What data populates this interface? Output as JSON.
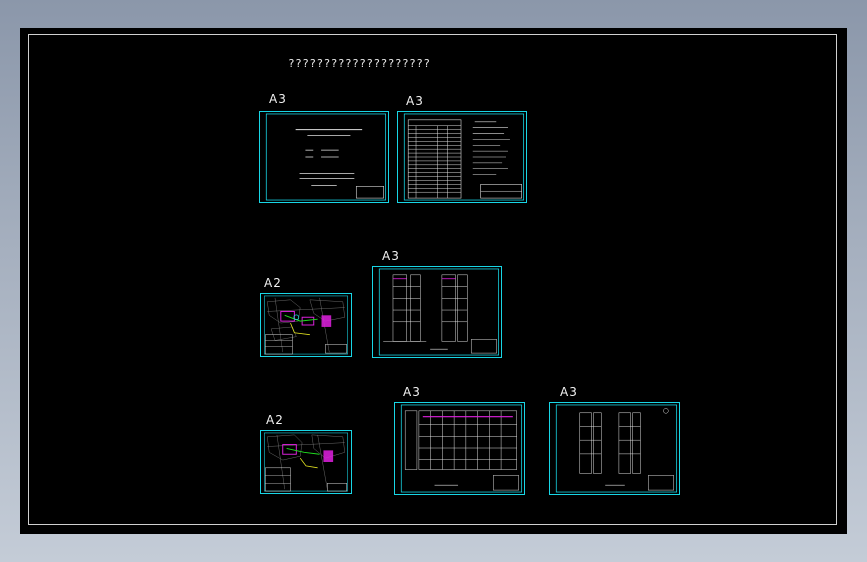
{
  "drawing": {
    "title": "????????????????????",
    "sheets": [
      {
        "id": "s1",
        "size": "A3",
        "kind": "cover"
      },
      {
        "id": "s2",
        "size": "A3",
        "kind": "index"
      },
      {
        "id": "s3",
        "size": "A2",
        "kind": "site-plan"
      },
      {
        "id": "s4",
        "size": "A3",
        "kind": "system-diagram"
      },
      {
        "id": "s5",
        "size": "A2",
        "kind": "site-plan"
      },
      {
        "id": "s6",
        "size": "A3",
        "kind": "wide-diagram"
      },
      {
        "id": "s7",
        "size": "A3",
        "kind": "system-diagram"
      }
    ]
  },
  "colors": {
    "sheet_border": "#18d6e6",
    "canvas_bg": "#000000",
    "line_white": "#e0e0e0",
    "accent_magenta": "#e020e0",
    "accent_green": "#20e020",
    "accent_yellow": "#e0e020"
  }
}
